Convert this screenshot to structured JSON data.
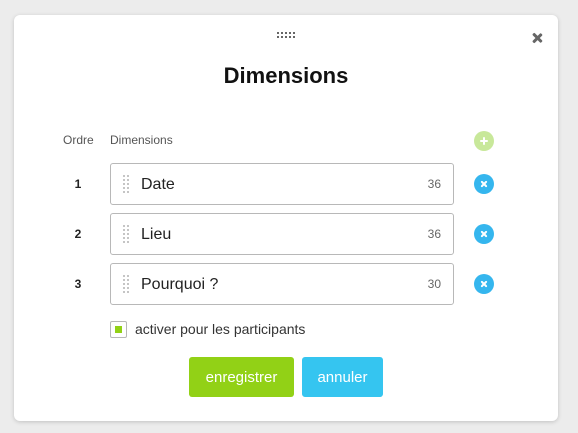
{
  "dialog": {
    "title": "Dimensions"
  },
  "table": {
    "order_header": "Ordre",
    "dimensions_header": "Dimensions"
  },
  "rows": [
    {
      "order": "1",
      "value": "Date",
      "count": "36"
    },
    {
      "order": "2",
      "value": "Lieu",
      "count": "36"
    },
    {
      "order": "3",
      "value": "Pourquoi ?",
      "count": "30"
    }
  ],
  "participants": {
    "label": "activer pour les participants",
    "checked": true
  },
  "actions": {
    "save_label": "enregistrer",
    "cancel_label": "annuler"
  },
  "icons": {
    "drag_handle": "drag-dots-icon",
    "close": "close-x-icon",
    "add": "plus-circle-icon",
    "remove": "x-circle-icon",
    "grip": "grip-vertical-icon"
  },
  "colors": {
    "accent_green": "#92d116",
    "accent_green_light": "#c8e89a",
    "accent_blue": "#35b6ee",
    "cancel_blue": "#35c5f0"
  }
}
